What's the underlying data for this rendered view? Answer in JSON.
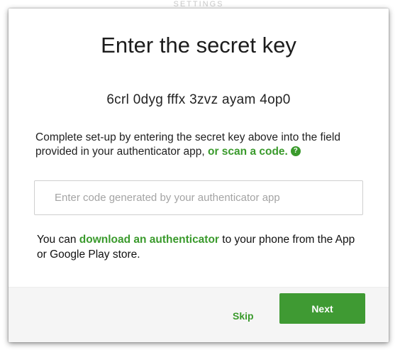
{
  "background": {
    "partial_text": "SETTINGS"
  },
  "modal": {
    "title": "Enter the secret key",
    "secret_key": "6crl 0dyg fffx 3zvz ayam 4op0",
    "instructions": {
      "text_before": "Complete set-up by entering the secret key above into the field provided in your authenticator app, ",
      "scan_link": "or scan a code.",
      "help_icon_glyph": "?"
    },
    "code_input": {
      "value": "",
      "placeholder": "Enter code generated by your authenticator app"
    },
    "download": {
      "text_before": "You can ",
      "link": "download an authenticator",
      "text_after": " to your phone from the App or Google Play store."
    },
    "footer": {
      "skip_label": "Skip",
      "next_label": "Next"
    }
  },
  "colors": {
    "accent_green": "#3a9a2c",
    "next_button_bg": "#3f9a33",
    "footer_bg": "#f5f5f5"
  },
  "icons": {
    "help": "question-circle-icon"
  }
}
